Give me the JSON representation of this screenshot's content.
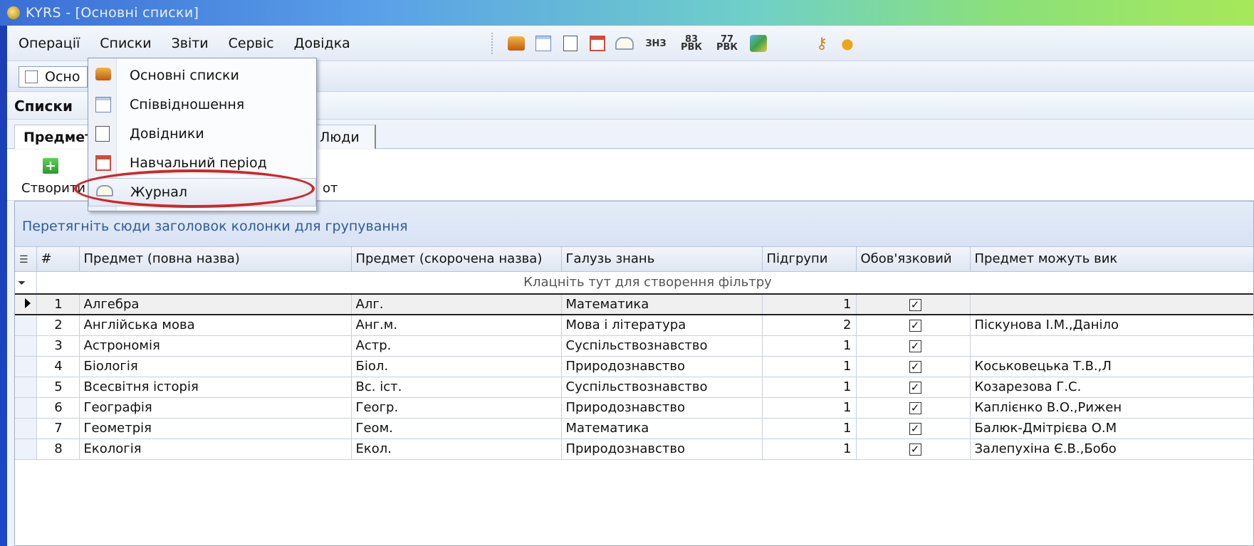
{
  "window": {
    "title": "KYRS - [Основні списки]"
  },
  "menu": [
    "Операції",
    "Списки",
    "Звіти",
    "Сервіс",
    "Довідка"
  ],
  "toolbar": {
    "label_zno": "ЗНЗ",
    "label_83": "83\nРВК",
    "label_77": "77\nРВК"
  },
  "doc_tab": {
    "label": "Осно"
  },
  "section": {
    "title": "Списки"
  },
  "tabs": {
    "active": "Предмет",
    "people": "Люди"
  },
  "actions": {
    "create": "Створити",
    "export_partial": "от"
  },
  "grid": {
    "group_hint": "Перетягніть сюди заголовок колонки для групування",
    "filter_hint": "Клацніть тут для створення фільтру",
    "columns": [
      "#",
      "Предмет (повна назва)",
      "Предмет (скорочена назва)",
      "Галузь знань",
      "Підгрупи",
      "Обов'язковий",
      "Предмет можуть вик"
    ],
    "rows": [
      {
        "n": "1",
        "full": "Алгебра",
        "short": "Алг.",
        "field": "Математика",
        "sub": "1",
        "req": true,
        "teachers": ""
      },
      {
        "n": "2",
        "full": "Англійська мова",
        "short": "Анг.м.",
        "field": "Мова і література",
        "sub": "2",
        "req": true,
        "teachers": "Піскунова І.М.,Даніло"
      },
      {
        "n": "3",
        "full": "Астрономія",
        "short": "Астр.",
        "field": "Суспільствознавство",
        "sub": "1",
        "req": true,
        "teachers": ""
      },
      {
        "n": "4",
        "full": "Біологія",
        "short": "Біол.",
        "field": "Природознавство",
        "sub": "1",
        "req": true,
        "teachers": "Коськовецька Т.В.,Л"
      },
      {
        "n": "5",
        "full": "Всесвітня історія",
        "short": "Вс. іст.",
        "field": "Суспільствознавство",
        "sub": "1",
        "req": true,
        "teachers": "Козарезова Г.С."
      },
      {
        "n": "6",
        "full": "Географія",
        "short": "Геогр.",
        "field": "Природознавство",
        "sub": "1",
        "req": true,
        "teachers": "Каплієнко В.О.,Рижен"
      },
      {
        "n": "7",
        "full": "Геометрія",
        "short": "Геом.",
        "field": "Математика",
        "sub": "1",
        "req": true,
        "teachers": "Балюк-Дмітрієва О.М"
      },
      {
        "n": "8",
        "full": "Екологія",
        "short": "Екол.",
        "field": "Природознавство",
        "sub": "1",
        "req": true,
        "teachers": "Залепухіна Є.В.,Бобо"
      }
    ]
  },
  "dropdown": {
    "items": [
      "Основні списки",
      "Співвідношення",
      "Довідники",
      "Навчальний період",
      "Журнал"
    ],
    "icons": [
      "books-icon",
      "list-icon",
      "checklist-icon",
      "calendar-icon",
      "journal-book-icon"
    ]
  },
  "colors": {
    "highlight_ring": "#d42626",
    "group_text": "#2f5aa0"
  }
}
